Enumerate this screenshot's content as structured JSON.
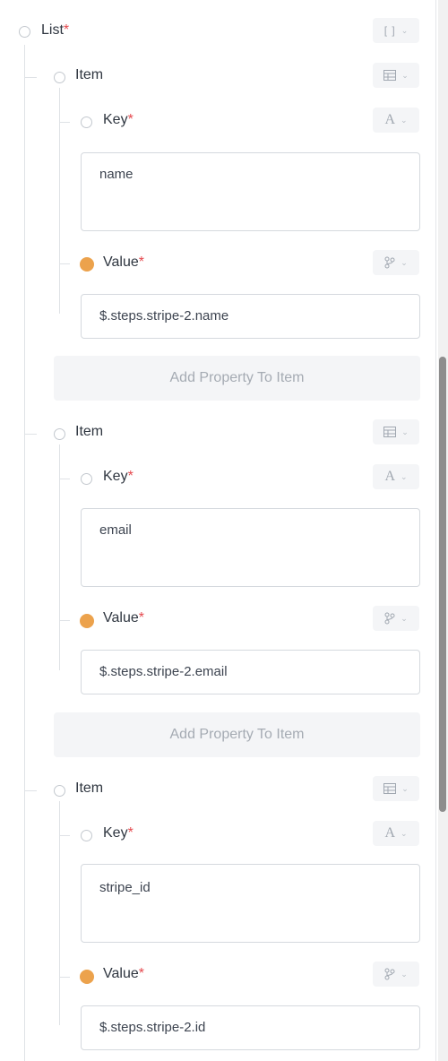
{
  "list": {
    "label": "List",
    "required_mark": "*",
    "type_glyph": "[ ]",
    "items": [
      {
        "label": "Item",
        "key": {
          "label": "Key",
          "required_mark": "*",
          "type_glyph": "A",
          "value": "name"
        },
        "value": {
          "label": "Value",
          "required_mark": "*",
          "input": "$.steps.stripe-2.name"
        },
        "add_label": "Add Property To Item"
      },
      {
        "label": "Item",
        "key": {
          "label": "Key",
          "required_mark": "*",
          "type_glyph": "A",
          "value": "email"
        },
        "value": {
          "label": "Value",
          "required_mark": "*",
          "input": "$.steps.stripe-2.email"
        },
        "add_label": "Add Property To Item"
      },
      {
        "label": "Item",
        "key": {
          "label": "Key",
          "required_mark": "*",
          "type_glyph": "A",
          "value": "stripe_id"
        },
        "value": {
          "label": "Value",
          "required_mark": "*",
          "input": "$.steps.stripe-2.id"
        }
      }
    ]
  },
  "icons": {
    "list_type": "brackets-icon",
    "item_type": "table-icon",
    "key_type": "text-a-icon",
    "value_type": "branch-icon",
    "chevron": "chevron-down-icon"
  },
  "colors": {
    "value_dot": "#eca24c",
    "required": "#e5484d"
  }
}
